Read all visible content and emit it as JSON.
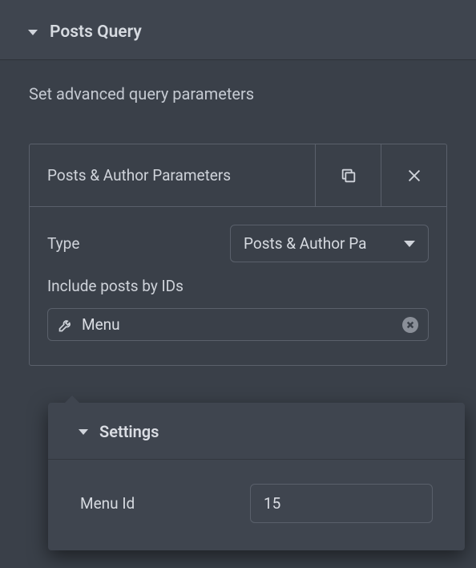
{
  "header": {
    "title": "Posts Query"
  },
  "description": "Set advanced query parameters",
  "panel": {
    "title": "Posts & Author Parameters",
    "fields": {
      "type": {
        "label": "Type",
        "value": "Posts & Author Pa"
      },
      "include_ids": {
        "label": "Include posts by IDs",
        "chip_value": "Menu"
      }
    }
  },
  "popover": {
    "title": "Settings",
    "fields": {
      "menu_id": {
        "label": "Menu Id",
        "value": "15"
      }
    }
  }
}
